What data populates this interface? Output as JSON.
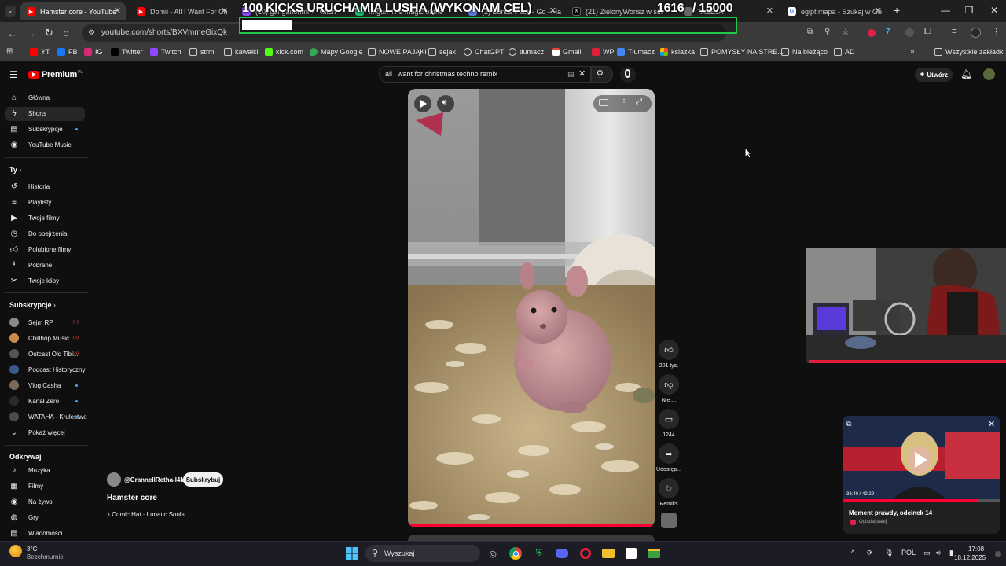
{
  "browser": {
    "tabs": [
      {
        "title": "Hamster core - YouTube",
        "active": true
      },
      {
        "title": "Domii - All I Want For Ch",
        "active": false
      },
      {
        "title": "(10) ganganonmr - Twitch",
        "active": false
      },
      {
        "title": "Imgur: The magic of the",
        "active": false
      },
      {
        "title": "(2) Bonus Pack - Go - Hay",
        "active": false
      },
      {
        "title": "(21) ZielonyWonsz w ser",
        "active": false
      },
      {
        "title": "TABEJA",
        "active": false
      },
      {
        "title": "egipt mapa - Szukaj w Go",
        "active": false
      }
    ],
    "url": "youtube.com/shorts/BXVmmeGixQk"
  },
  "overlay": {
    "goal_text": "100 KICKS URUCHAMIA LUSHA (WYKONAM CEL)",
    "counter": "1616",
    "goal": "/ 15000"
  },
  "bookmarks": [
    {
      "label": "YT",
      "icon": "youtube-icon"
    },
    {
      "label": "FB",
      "icon": "facebook-icon"
    },
    {
      "label": "IG",
      "icon": "instagram-icon"
    },
    {
      "label": "Twitter",
      "icon": "x-icon"
    },
    {
      "label": "Twitch",
      "icon": "twitch-icon"
    },
    {
      "label": "strm",
      "icon": "folder-icon"
    },
    {
      "label": "kawałki",
      "icon": "folder-icon"
    },
    {
      "label": "kick.com",
      "icon": "kick-icon"
    },
    {
      "label": "Mapy Google",
      "icon": "maps-icon"
    },
    {
      "label": "NOWE PAJĄKI",
      "icon": "folder-icon"
    },
    {
      "label": "sejak",
      "icon": "folder-icon"
    },
    {
      "label": "ChatGPT",
      "icon": "chatgpt-icon"
    },
    {
      "label": "tłumacz",
      "icon": "chatgpt-icon"
    },
    {
      "label": "Gmail",
      "icon": "gmail-icon"
    },
    {
      "label": "WP",
      "icon": "wp-icon"
    },
    {
      "label": "Tłumacz",
      "icon": "translate-icon"
    },
    {
      "label": "ksiazka",
      "icon": "windows-icon"
    },
    {
      "label": "POMYSŁY NA STRE...",
      "icon": "folder-icon"
    },
    {
      "label": "Na bieżąco",
      "icon": "folder-icon"
    },
    {
      "label": "AD",
      "icon": "folder-icon"
    },
    {
      "label": "Wszystkie zakładki",
      "icon": "folder-icon"
    }
  ],
  "youtube": {
    "logo_text": "Premium",
    "logo_sup": "PL",
    "search_query": "all i want for christmas techno remix",
    "create_label": "Utwórz",
    "sidebar_main": [
      {
        "label": "Główna",
        "icon": "home-icon"
      },
      {
        "label": "Shorts",
        "icon": "shorts-icon"
      },
      {
        "label": "Subskrypcje",
        "icon": "subscriptions-icon"
      },
      {
        "label": "YouTube Music",
        "icon": "music-icon"
      }
    ],
    "you_section": "Ty",
    "sidebar_you": [
      {
        "label": "Historia",
        "icon": "history-icon"
      },
      {
        "label": "Playlisty",
        "icon": "playlist-icon"
      },
      {
        "label": "Twoje filmy",
        "icon": "video-icon"
      },
      {
        "label": "Do obejrzenia",
        "icon": "clock-icon"
      },
      {
        "label": "Polubione filmy",
        "icon": "thumb-up-icon"
      },
      {
        "label": "Pobrane",
        "icon": "download-icon"
      },
      {
        "label": "Twoje klipy",
        "icon": "scissors-icon"
      }
    ],
    "subs_section": "Subskrypcje",
    "subscriptions": [
      {
        "label": "Sejm RP",
        "color": "#8a8a8a",
        "marker": "live"
      },
      {
        "label": "Chillhop Music",
        "color": "#c98a4a",
        "marker": "live"
      },
      {
        "label": "Outcast Old Tibi...",
        "color": "#555555",
        "marker": "live"
      },
      {
        "label": "Podcast Historyczny",
        "color": "#3a5a8a",
        "marker": ""
      },
      {
        "label": "Vlog Casha",
        "color": "#7a6a5a",
        "marker": "dot"
      },
      {
        "label": "Kanał Zero",
        "color": "#2a2a2a",
        "marker": "dot"
      },
      {
        "label": "WATAHA - Krulestwo",
        "color": "#4a4a4a",
        "marker": "dot"
      }
    ],
    "show_more": "Pokaż więcej",
    "explore_section": "Odkrywaj",
    "sidebar_explore": [
      {
        "label": "Muzyka",
        "icon": "music-note-icon"
      },
      {
        "label": "Filmy",
        "icon": "film-icon"
      },
      {
        "label": "Na żywo",
        "icon": "live-icon"
      },
      {
        "label": "Gry",
        "icon": "gamepad-icon"
      },
      {
        "label": "Wiadomości",
        "icon": "news-icon"
      }
    ],
    "short": {
      "channel": "@CrannellRetha-l4k",
      "subscribe_label": "Subskrybuj",
      "title": "Hamster core",
      "music": "♪ Comic Hat · Lunatic Souls",
      "likes": "201 tys.",
      "dislike_label": "Nie ...",
      "comments": "1244",
      "share_label": "Udostęp...",
      "remix_label": "Remiks"
    },
    "mini_player": {
      "time": "36:40 / 42:29",
      "title": "Moment prawdy, odcinek 14",
      "status": "Oglądaj dalej",
      "progress": 0.863
    }
  },
  "taskbar": {
    "weather_temp": "3°C",
    "weather_desc": "Bezchmurnie",
    "search_label": "Wyszukaj",
    "lang": "POL",
    "time": "17:08",
    "date": "18.12.2025"
  }
}
